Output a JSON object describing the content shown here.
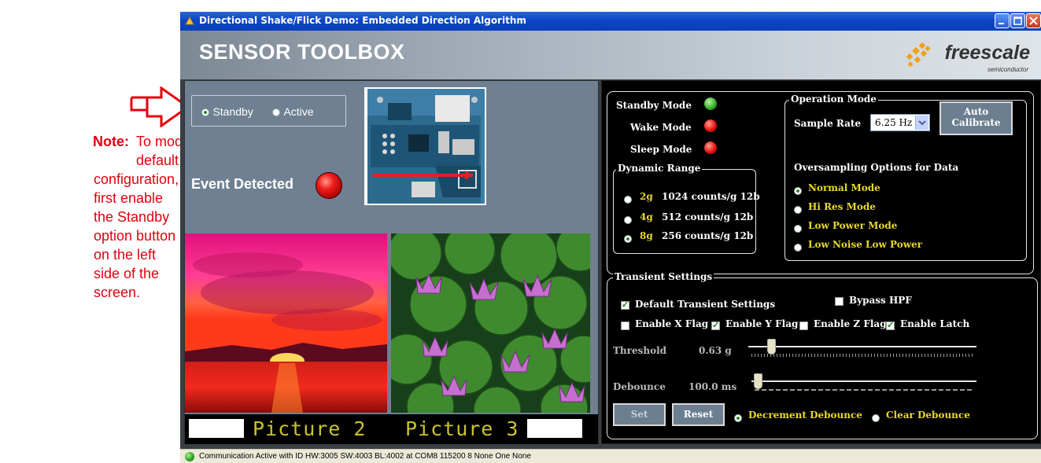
{
  "note": {
    "label": "Note:",
    "lines": [
      "To modify the",
      "default",
      "configuration,",
      "first enable",
      "the Standby",
      "option button",
      "on the left",
      "side of the",
      "screen."
    ]
  },
  "window": {
    "title": "Directional Shake/Flick Demo: Embedded Direction Algorithm",
    "banner_title": "SENSOR TOOLBOX",
    "logo_text": "freescale",
    "logo_sub": "semiconductor"
  },
  "left": {
    "mode_standby": "Standby",
    "mode_active": "Active",
    "mode_selected": "Standby",
    "event_label": "Event Detected",
    "picture2": "Picture 2",
    "picture3": "Picture 3"
  },
  "status_indicators": [
    {
      "label": "Standby Mode",
      "state": "green"
    },
    {
      "label": "Wake Mode",
      "state": "red"
    },
    {
      "label": "Sleep Mode",
      "state": "red"
    }
  ],
  "dynamic_range": {
    "title": "Dynamic Range",
    "options": [
      {
        "g": "2g",
        "desc": "1024 counts/g 12b",
        "selected": false
      },
      {
        "g": "4g",
        "desc": "512 counts/g 12b",
        "selected": false
      },
      {
        "g": "8g",
        "desc": "256 counts/g 12b",
        "selected": true
      }
    ]
  },
  "operation_mode": {
    "title": "Operation Mode",
    "sample_rate_label": "Sample Rate",
    "sample_rate_value": "6.25 Hz",
    "auto_calibrate_line1": "Auto",
    "auto_calibrate_line2": "Calibrate",
    "oversampling_title": "Oversampling Options for Data",
    "oversampling_options": [
      {
        "label": "Normal Mode",
        "selected": true
      },
      {
        "label": "Hi Res Mode",
        "selected": false
      },
      {
        "label": "Low Power Mode",
        "selected": false
      },
      {
        "label": "Low Noise Low Power",
        "selected": false
      }
    ]
  },
  "transient": {
    "title": "Transient Settings",
    "default_settings": "Default Transient Settings",
    "default_checked": true,
    "bypass_hpf": "Bypass HPF",
    "bypass_checked": false,
    "flags": [
      {
        "label": "Enable X Flag",
        "checked": false
      },
      {
        "label": "Enable Y Flag",
        "checked": true
      },
      {
        "label": "Enable Z Flag",
        "checked": false
      },
      {
        "label": "Enable Latch",
        "checked": true
      }
    ],
    "threshold_label": "Threshold",
    "threshold_value": "0.63 g",
    "debounce_label": "Debounce",
    "debounce_value": "100.0 ms",
    "set_label": "Set",
    "reset_label": "Reset",
    "decrement_debounce": "Decrement Debounce",
    "clear_debounce": "Clear Debounce",
    "debounce_mode": "Decrement Debounce"
  },
  "status_bar": {
    "text": "Communication Active with ID HW:3005 SW:4003 BL:4002 at COM8 115200 8 None One None"
  }
}
